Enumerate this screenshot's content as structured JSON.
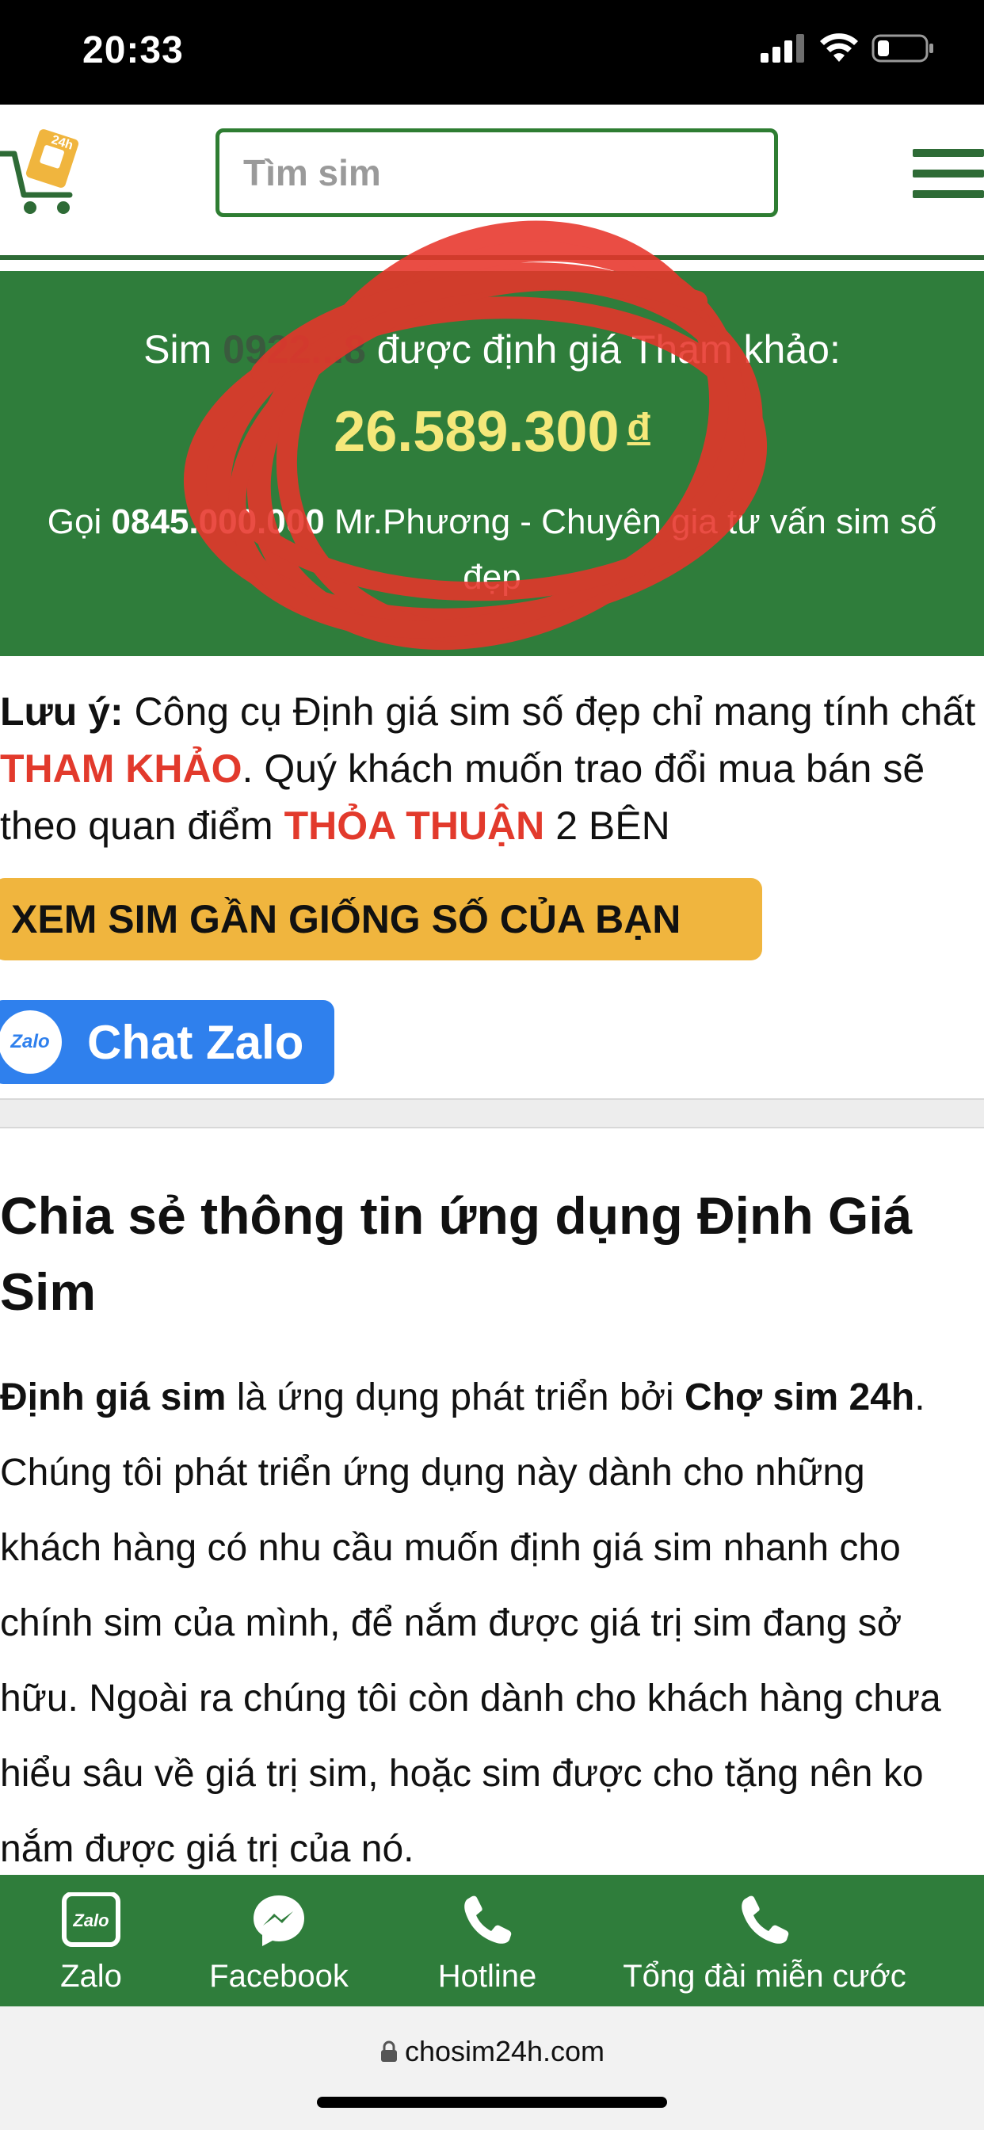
{
  "status_bar": {
    "time": "20:33"
  },
  "header": {
    "search_placeholder": "Tìm sim"
  },
  "result": {
    "prefix": "Sim",
    "sim_number": "0922...8",
    "suffix": "được định giá Tham khảo:",
    "price": "26.589.300",
    "price_unit": "đ",
    "consult_prefix": "Gọi",
    "consult_phone": "0845.000.000",
    "consult_suffix": "Mr.Phương - Chuyên gia tư vấn sim số đẹp"
  },
  "note": {
    "label": "Lưu ý:",
    "text1": "Công cụ Định giá sim số đẹp chỉ mang tính chất",
    "highlight1": "THAM KHẢO",
    "text2": ". Quý khách muốn trao đổi mua bán sẽ theo quan điểm",
    "highlight2": "THỎA THUẬN",
    "text3": "2 BÊN"
  },
  "similar_button": "XEM SIM GẦN GIỐNG SỐ CỦA BẠN",
  "zalo_chat": {
    "icon_text": "Zalo",
    "label": "Chat Zalo"
  },
  "article": {
    "title": "Chia sẻ thông tin ứng dụng Định Giá Sim",
    "bold1": "Định giá sim",
    "text1": "là ứng dụng phát triển bởi",
    "bold2": "Chợ sim 24h",
    "text2": ". Chúng tôi phát triển ứng dụng này dành cho những khách hàng có nhu cầu muốn định giá sim nhanh cho chính sim của mình, để nắm được giá trị sim đang sở hữu. Ngoài ra chúng tôi còn dành cho khách hàng chưa hiểu sâu về giá trị sim, hoặc sim được cho tặng nên ko nắm được giá trị của nó."
  },
  "bottom_nav": {
    "zalo": "Zalo",
    "zalo_icon_text": "Zalo",
    "facebook": "Facebook",
    "hotline": "Hotline",
    "free_call": "Tổng đài miễn cước"
  },
  "browser": {
    "url": "chosim24h.com"
  },
  "colors": {
    "brand_green": "#2f7d3b",
    "price_yellow": "#f5e87a",
    "highlight_red": "#e23a2c",
    "button_orange": "#f0b53e",
    "zalo_blue": "#2f80ed",
    "scribble_red": "#e8352b"
  }
}
